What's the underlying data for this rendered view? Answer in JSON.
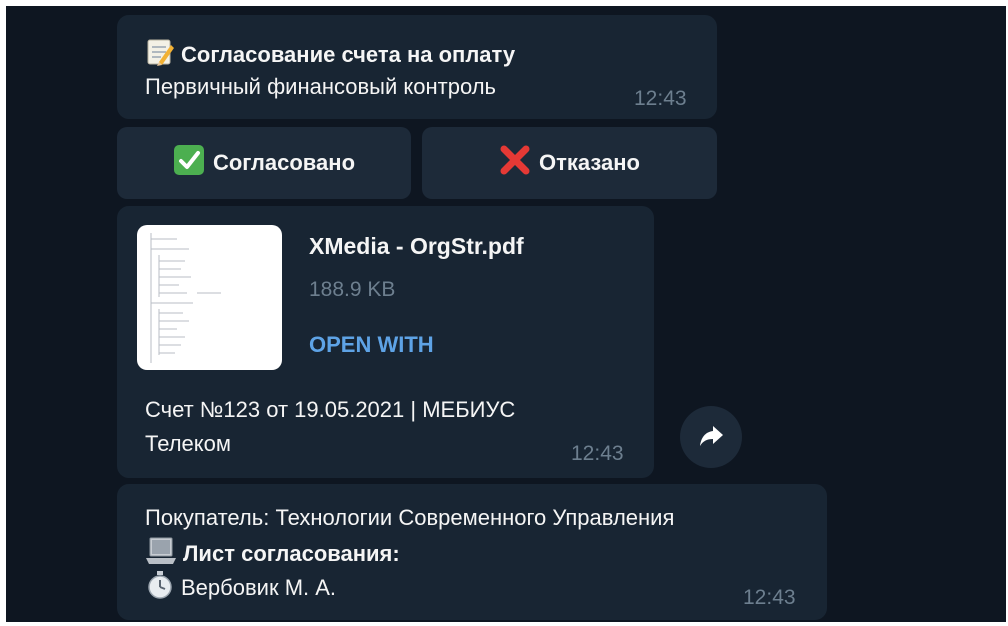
{
  "msg1": {
    "title": "Согласование счета на оплату",
    "subtitle": "Первичный финансовый контроль",
    "time": "12:43",
    "icon": "memo-icon"
  },
  "buttons": {
    "approve": {
      "label": "Согласовано",
      "icon": "check-mark-icon",
      "color": "#4caf50"
    },
    "reject": {
      "label": "Отказано",
      "icon": "cross-mark-icon",
      "color": "#e53935"
    }
  },
  "file": {
    "name": "XMedia - OrgStr.pdf",
    "size": "188.9 KB",
    "action": "OPEN WITH",
    "caption_line1": "Счет №123 от 19.05.2021 | МЕБИУС",
    "caption_line2": "Телеком",
    "time": "12:43"
  },
  "msg3": {
    "buyer": "Покупатель: Технологии Современного Управления",
    "sheet_title": "Лист согласования:",
    "approver": "Вербовик М. А.",
    "time": "12:43"
  },
  "colors": {
    "background": "#0e1621",
    "bubble": "#182533",
    "link": "#5ea3e6",
    "meta": "#6d7f8f"
  }
}
